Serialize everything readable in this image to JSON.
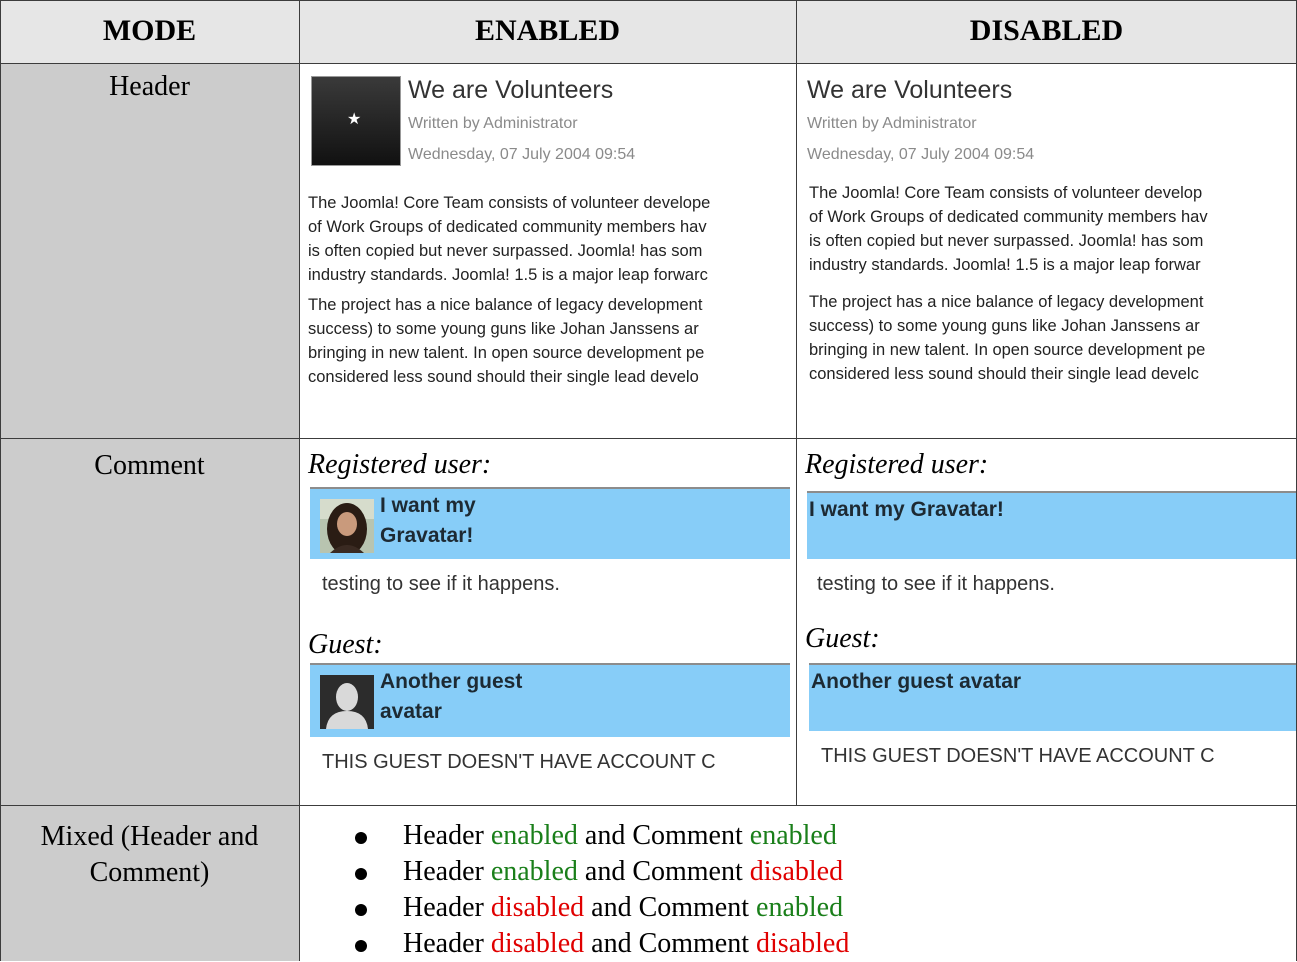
{
  "table": {
    "col_mode": "MODE",
    "col_enabled": "ENABLED",
    "col_disabled": "DISABLED"
  },
  "rows": {
    "header_label": "Header",
    "comment_label": "Comment",
    "mixed_label_line1": "Mixed (Header and",
    "mixed_label_line2": "Comment)"
  },
  "article": {
    "title": "We are Volunteers",
    "author": "Written by Administrator",
    "date": "Wednesday, 07 July 2004 09:54",
    "enabled_lines": [
      "The Joomla! Core Team consists of volunteer develope",
      "of Work Groups of dedicated community members hav",
      "is often copied but never surpassed. Joomla! has som",
      "industry standards. Joomla! 1.5 is a major leap forwarc",
      "The project has a nice balance of legacy development",
      "success) to some young guns like Johan Janssens ar",
      "bringing in new talent. In open source development pe",
      "considered less sound should their single lead develo"
    ],
    "disabled_lines": [
      "The Joomla! Core Team consists of volunteer develop",
      "of Work Groups of dedicated community members hav",
      "is often copied but never surpassed. Joomla! has som",
      "industry standards. Joomla! 1.5 is a major leap forwar",
      "The project has a nice balance of legacy development",
      "success) to some young guns like Johan Janssens ar",
      "bringing in new talent. In open source development pe",
      "considered less sound should their single lead develc"
    ],
    "thumb_icon": "star-icon"
  },
  "comments": {
    "registered_label": "Registered user:",
    "guest_label": "Guest:",
    "reg_name_line1": "I want my",
    "reg_name_line2": "Gravatar!",
    "reg_name_full": "I want my Gravatar!",
    "reg_text": "testing to see if it happens.",
    "guest_name_line1": "Another guest",
    "guest_name_line2": "avatar",
    "guest_name_full": "Another guest avatar",
    "guest_text_enabled": "THIS GUEST DOESN'T HAVE ACCOUNT C",
    "guest_text_disabled": "THIS GUEST DOESN'T HAVE ACCOUNT C",
    "box_color": "#87cdf8"
  },
  "mixed": {
    "items": [
      {
        "a": "Header ",
        "a_state": "enabled",
        "b": " and Comment  ",
        "b_state": "enabled"
      },
      {
        "a": "Header ",
        "a_state": "enabled",
        "b": " and Comment ",
        "b_state": "disabled"
      },
      {
        "a": "Header ",
        "a_state": "disabled",
        "b": " and Comment  ",
        "b_state": "enabled"
      },
      {
        "a": "Header ",
        "a_state": "disabled",
        "b": " and Comment ",
        "b_state": "disabled"
      }
    ],
    "enabled_color": "#1a7f1a",
    "disabled_color": "#e00000"
  }
}
